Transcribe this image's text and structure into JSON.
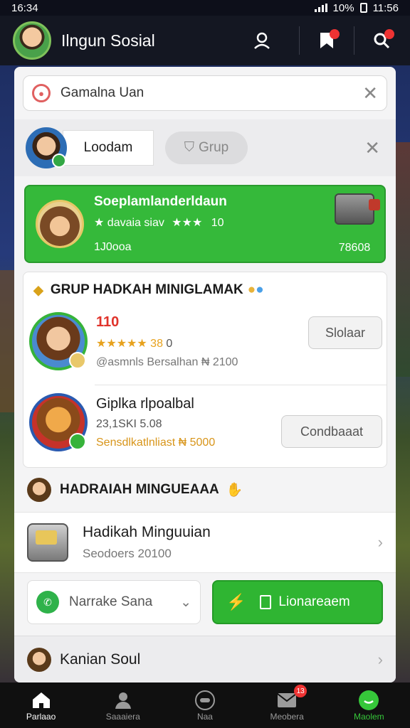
{
  "status_bar": {
    "time_left": "16:34",
    "battery": "10%",
    "time_right": "11:56"
  },
  "header": {
    "title": "Ilngun Sosial"
  },
  "search": {
    "value": "Gamalna Uan"
  },
  "tabs": [
    {
      "label": "Loodam"
    },
    {
      "label": "Grup"
    }
  ],
  "promo": {
    "title": "Soeplamlanderldaun",
    "subtitle": "davaia siav",
    "rating_value": "10",
    "count_left": "1J0ooa",
    "count_right": "78608"
  },
  "weekly_group": {
    "heading": "GRUP HADKAH MINIGLAMAK",
    "items": [
      {
        "name": "110",
        "stars": "★★★★★",
        "rating": "38",
        "rating_suffix": "0",
        "detail": "@asmnls Bersalhan ₦ 2100",
        "button": "Slolaar"
      },
      {
        "name": "Giplka rlpoalbal",
        "stars": "",
        "rating": "23,1SKI 5.08",
        "rating_suffix": "",
        "detail": "Sensdlkatlnliast ₦ 5000",
        "button": "Condbaaat"
      }
    ]
  },
  "weekly_prize": {
    "heading": "HADRAIAH MINGUEAAA",
    "title": "Hadikah Minguuian",
    "subtitle": "Seodoers 20100"
  },
  "actions": {
    "share_label": "Narrake Sana",
    "primary_label": "Lionareaem"
  },
  "social_section": {
    "title": "Kanian Soul"
  },
  "bottom_nav": [
    {
      "label": "Parlaao",
      "icon": "home-icon"
    },
    {
      "label": "Saaaiera",
      "icon": "person-icon"
    },
    {
      "label": "Naa",
      "icon": "game-icon"
    },
    {
      "label": "Meobera",
      "icon": "mail-icon",
      "badge": "13"
    },
    {
      "label": "Maolem",
      "icon": "profile-icon"
    }
  ],
  "colors": {
    "accent_green": "#35b93a",
    "badge_red": "#e33333",
    "header_bg": "#141722"
  }
}
